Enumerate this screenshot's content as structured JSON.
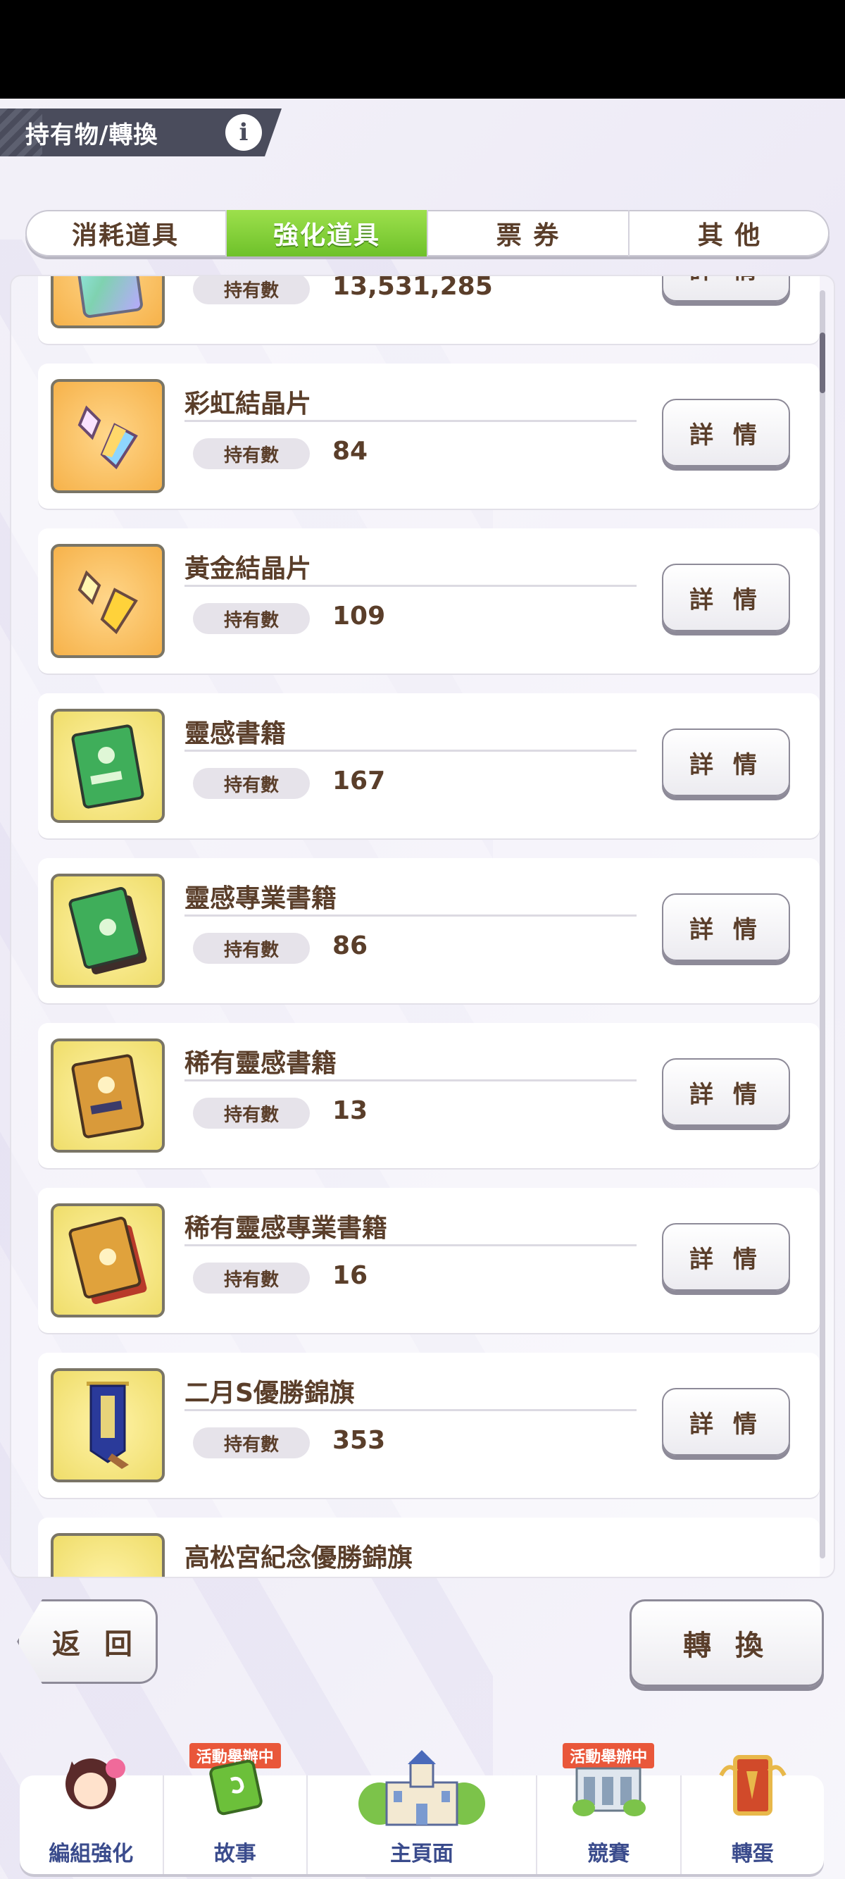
{
  "header": {
    "title": "持有物/轉換",
    "info_icon": "i"
  },
  "tabs": [
    {
      "label": "消耗道具",
      "active": false
    },
    {
      "label": "強化道具",
      "active": true
    },
    {
      "label": "票 券",
      "active": false
    },
    {
      "label": "其 他",
      "active": false
    }
  ],
  "list": {
    "own_label": "持有數",
    "detail_label": "詳 情",
    "items": [
      {
        "name": "",
        "count": "13,531,285",
        "icon": "card-icon"
      },
      {
        "name": "彩虹結晶片",
        "count": "84",
        "icon": "rainbow-crystal-icon"
      },
      {
        "name": "黃金結晶片",
        "count": "109",
        "icon": "gold-crystal-icon"
      },
      {
        "name": "靈感書籍",
        "count": "167",
        "icon": "book-icon"
      },
      {
        "name": "靈感專業書籍",
        "count": "86",
        "icon": "pro-book-icon"
      },
      {
        "name": "稀有靈感書籍",
        "count": "13",
        "icon": "rare-book-icon"
      },
      {
        "name": "稀有靈感專業書籍",
        "count": "16",
        "icon": "rare-pro-book-icon"
      },
      {
        "name": "二月S優勝錦旗",
        "count": "353",
        "icon": "pennant-icon"
      },
      {
        "name": "高松宮紀念優勝錦旗",
        "count": "",
        "icon": "pennant-icon"
      }
    ]
  },
  "buttons": {
    "back": "返 回",
    "convert": "轉 換"
  },
  "nav": {
    "event_badge": "活動舉辦中",
    "items": [
      {
        "label": "編組強化"
      },
      {
        "label": "故事"
      },
      {
        "label": "主頁面"
      },
      {
        "label": "競賽"
      },
      {
        "label": "轉蛋"
      }
    ]
  },
  "colors": {
    "active_tab": "#7bcb33",
    "text_brown": "#5a3e2a",
    "nav_text": "#3a4b8c"
  }
}
